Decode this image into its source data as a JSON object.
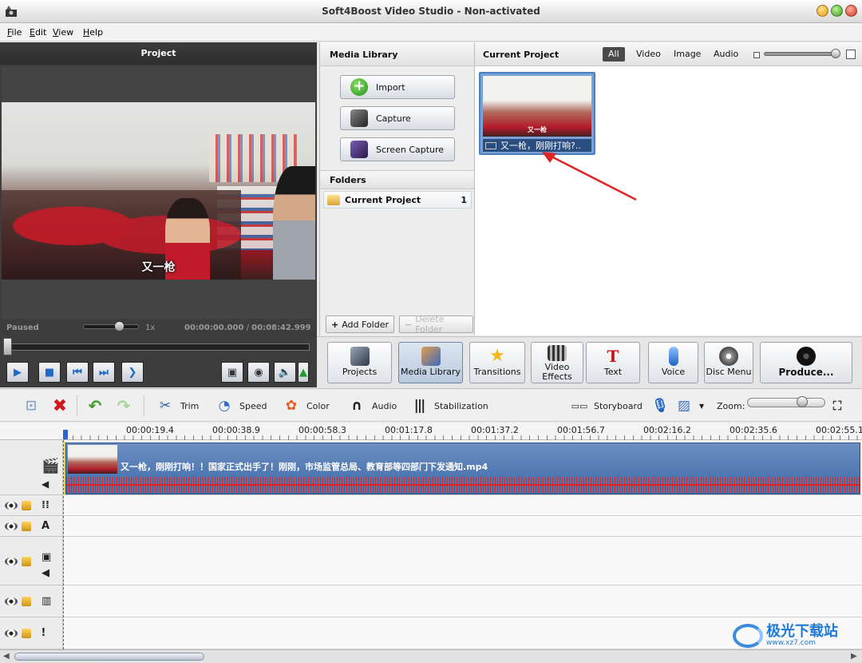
{
  "window": {
    "title": "Soft4Boost Video Studio - Non-activated"
  },
  "menu": [
    {
      "label": "File",
      "u": "F",
      "rest": "ile"
    },
    {
      "label": "Edit",
      "u": "E",
      "rest": "dit"
    },
    {
      "label": "View",
      "u": "V",
      "rest": "iew"
    },
    {
      "label": "Help",
      "u": "H",
      "rest": "elp"
    }
  ],
  "preview": {
    "header": "Project",
    "caption": "又一枪",
    "status": "Paused",
    "speed": "1x",
    "time_current": "00:00:00.000",
    "time_separator": "/",
    "time_total": "00:08:42.999",
    "volume_level": 0.6,
    "seek_position": 0.0
  },
  "media_library": {
    "header": "Media Library",
    "buttons": [
      {
        "label": "Import",
        "icon": "plus-icon"
      },
      {
        "label": "Capture",
        "icon": "capture-icon"
      },
      {
        "label": "Screen Capture",
        "icon": "screen-capture-icon"
      }
    ],
    "folders_header": "Folders",
    "folder": {
      "name": "Current Project",
      "count": "1"
    },
    "add_folder": "Add Folder",
    "delete_folder": "Delete Folder"
  },
  "current_project": {
    "header": "Current Project",
    "filters": [
      "All",
      "Video",
      "Image",
      "Audio"
    ],
    "active_filter": "All",
    "item_label": "又一枪，刚刚打响?..",
    "item_caption": "又一枪"
  },
  "big_toolbar": [
    {
      "label": "Projects"
    },
    {
      "label": "Media Library",
      "active": true
    },
    {
      "label": "Transitions"
    },
    {
      "label": "Video Effects"
    },
    {
      "label": "Text"
    },
    {
      "label": "Voice"
    },
    {
      "label": "Disc Menu"
    },
    {
      "label": "Produce..."
    }
  ],
  "timeline_toolbar": {
    "trim": "Trim",
    "speed": "Speed",
    "color": "Color",
    "audio": "Audio",
    "stabilization": "Stabilization",
    "storyboard": "Storyboard",
    "zoom": "Zoom:",
    "zoom_level": 0.65
  },
  "ruler": [
    "00:00:19.4",
    "00:00:38.9",
    "00:00:58.3",
    "00:01:17.8",
    "00:01:37.2",
    "00:01:56.7",
    "00:02:16.2",
    "00:02:35.6",
    "00:02:55.1"
  ],
  "clip": {
    "title": "又一枪，刚刚打响！！国家正式出手了！刚刚，市场监管总局、教育部等四部门下发通知.mp4"
  },
  "watermark": {
    "text": "极光下载站",
    "sub": "www.xz7.com"
  },
  "colors": {
    "accent": "#2f63c6",
    "clip": "#4f78b4",
    "waveform": "#e02020"
  }
}
